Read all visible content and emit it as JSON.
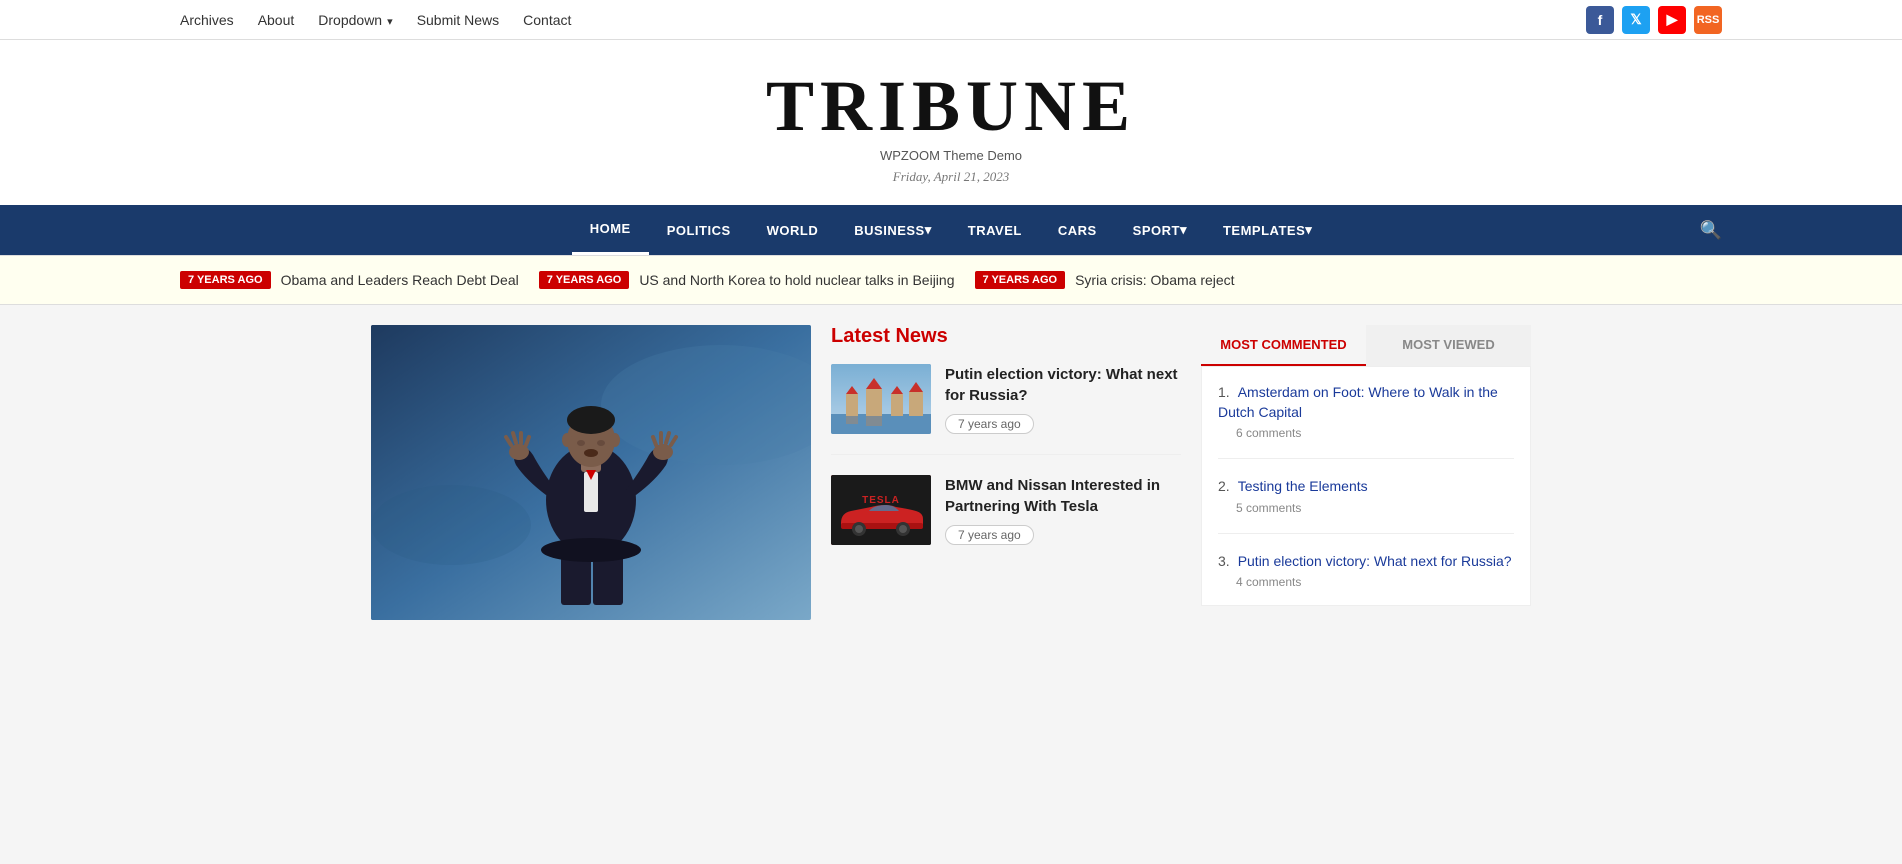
{
  "topnav": {
    "links": [
      {
        "label": "Archives",
        "href": "#"
      },
      {
        "label": "About",
        "href": "#"
      },
      {
        "label": "Dropdown",
        "href": "#",
        "dropdown": true
      },
      {
        "label": "Submit News",
        "href": "#"
      },
      {
        "label": "Contact",
        "href": "#"
      }
    ],
    "social": [
      {
        "name": "facebook",
        "icon": "f"
      },
      {
        "name": "twitter",
        "icon": "t"
      },
      {
        "name": "youtube",
        "icon": "▶"
      },
      {
        "name": "rss",
        "icon": "RSS"
      }
    ]
  },
  "masthead": {
    "title": "TRIBUNE",
    "subtitle": "WPZOOM Theme Demo",
    "date": "Friday, April 21, 2023"
  },
  "mainnav": {
    "items": [
      {
        "label": "HOME",
        "active": true
      },
      {
        "label": "POLITICS",
        "active": false
      },
      {
        "label": "WORLD",
        "active": false
      },
      {
        "label": "BUSINESS",
        "active": false,
        "dropdown": true
      },
      {
        "label": "TRAVEL",
        "active": false
      },
      {
        "label": "CARS",
        "active": false
      },
      {
        "label": "SPORT",
        "active": false,
        "dropdown": true
      },
      {
        "label": "TEMPLATES",
        "active": false,
        "dropdown": true
      }
    ]
  },
  "ticker": {
    "items": [
      {
        "badge": "7 YEARS AGO",
        "text": "Obama and Leaders Reach Debt Deal"
      },
      {
        "badge": "7 YEARS AGO",
        "text": "US and North Korea to hold nuclear talks in Beijing"
      },
      {
        "badge": "7 YEARS AGO",
        "text": "Syria crisis: Obama reject"
      }
    ]
  },
  "latest_news": {
    "title": "Latest News",
    "items": [
      {
        "title": "Putin election victory: What next for Russia?",
        "meta": "7 years ago",
        "thumb_type": "kremlin"
      },
      {
        "title": "BMW and Nissan Interested in Partnering With Tesla",
        "meta": "7 years ago",
        "thumb_type": "tesla"
      }
    ]
  },
  "sidebar": {
    "tabs": [
      {
        "label": "MOST COMMENTED",
        "active": true
      },
      {
        "label": "MOST VIEWED",
        "active": false
      }
    ],
    "most_commented": [
      {
        "num": "1.",
        "title": "Amsterdam on Foot: Where to Walk in the Dutch Capital",
        "meta": "6 comments"
      },
      {
        "num": "2.",
        "title": "Testing the Elements",
        "meta": "5 comments"
      },
      {
        "num": "3.",
        "title": "Putin election victory: What next for Russia?",
        "meta": "4 comments"
      }
    ]
  }
}
